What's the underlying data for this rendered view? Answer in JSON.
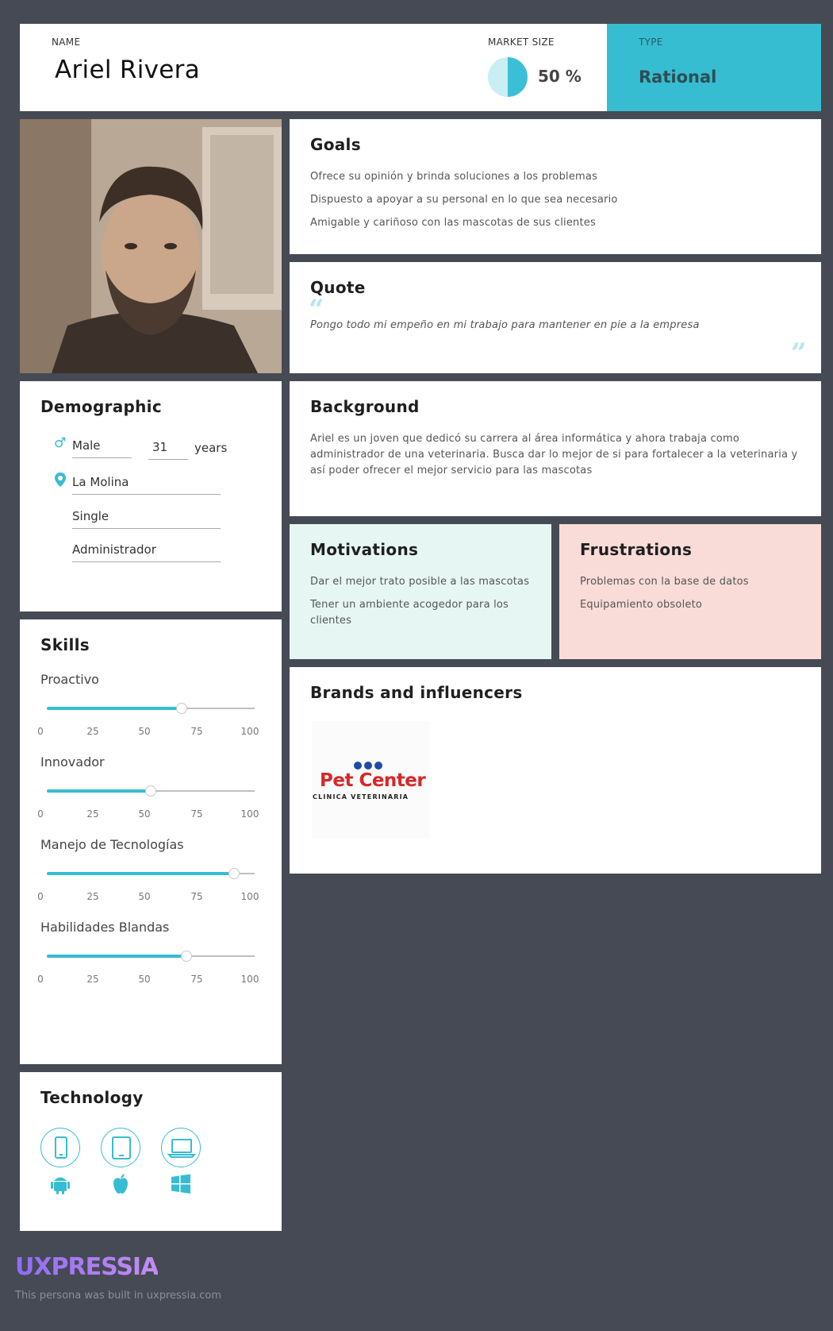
{
  "header": {
    "name_label": "NAME",
    "name": "Ariel Rivera",
    "market_label": "MARKET SIZE",
    "market_value": "50 %",
    "market_fraction": 0.5,
    "type_label": "TYPE",
    "type_value": "Rational"
  },
  "goals": {
    "title": "Goals",
    "items": [
      "Ofrece su opinión y brinda soluciones a los problemas",
      "Dispuesto a apoyar a su personal en lo que sea necesario",
      "Amigable y cariñoso con las mascotas de sus clientes"
    ]
  },
  "quote": {
    "title": "Quote",
    "text": "Pongo todo mi empeño en mi trabajo para mantener en pie a la empresa"
  },
  "background": {
    "title": "Background",
    "text": "Ariel es un joven que dedicó su carrera al área informática y ahora trabaja como administrador de una veterinaria. Busca dar lo mejor de si para fortalecer a la veterinaria y así poder ofrecer el mejor servicio para las mascotas"
  },
  "motivations": {
    "title": "Motivations",
    "items": [
      "Dar el mejor trato posible a las mascotas",
      "Tener un ambiente acogedor para los clientes"
    ]
  },
  "frustrations": {
    "title": "Frustrations",
    "items": [
      "Problemas con la base de datos",
      "Equipamiento obsoleto"
    ]
  },
  "brands": {
    "title": "Brands and influencers",
    "logo_main": "Pet Center",
    "logo_sub": "CLINICA VETERINARIA"
  },
  "demographic": {
    "title": "Demographic",
    "gender": "Male",
    "age": "31",
    "age_unit": "years",
    "location": "La Molina",
    "status": "Single",
    "occupation": "Administrador"
  },
  "skills": {
    "title": "Skills",
    "ticks": [
      "0",
      "25",
      "50",
      "75",
      "100"
    ],
    "items": [
      {
        "name": "Proactivo",
        "value": 65
      },
      {
        "name": "Innovador",
        "value": 50
      },
      {
        "name": "Manejo de Tecnologías",
        "value": 90
      },
      {
        "name": "Habilidades Blandas",
        "value": 67
      }
    ]
  },
  "technology": {
    "title": "Technology",
    "devices": [
      "smartphone-icon",
      "tablet-icon",
      "laptop-icon"
    ],
    "os": [
      "android-icon",
      "apple-icon",
      "windows-icon"
    ]
  },
  "footer": {
    "brand": "UXPRESSIA",
    "note": "This persona was built in uxpressia.com"
  },
  "colors": {
    "accent": "#36bdd1",
    "background": "#454a54",
    "motivations_bg": "#e6f7f3",
    "frustrations_bg": "#f9dcd8"
  }
}
